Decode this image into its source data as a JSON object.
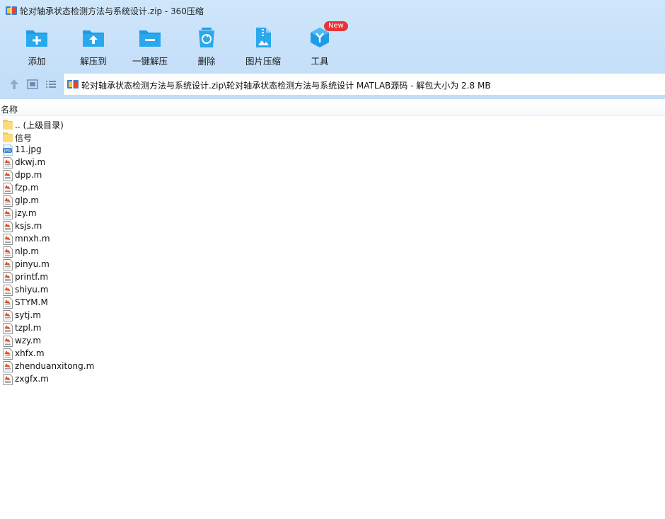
{
  "window": {
    "title": "轮对轴承状态检测方法与系统设计.zip - 360压缩"
  },
  "toolbar": {
    "items": [
      {
        "label": "添加",
        "icon": "add-icon"
      },
      {
        "label": "解压到",
        "icon": "extract-to-icon"
      },
      {
        "label": "一键解压",
        "icon": "one-click-extract-icon"
      },
      {
        "label": "删除",
        "icon": "delete-icon"
      },
      {
        "label": "图片压缩",
        "icon": "image-compress-icon"
      },
      {
        "label": "工具",
        "icon": "tools-icon",
        "badge": "New"
      }
    ]
  },
  "nav": {
    "path": "轮对轴承状态检测方法与系统设计.zip\\轮对轴承状态检测方法与系统设计 MATLAB源码 - 解包大小为 2.8 MB"
  },
  "columns": {
    "name": "名称"
  },
  "files": [
    {
      "name": ".. (上级目录)",
      "type": "folder"
    },
    {
      "name": "信号",
      "type": "folder"
    },
    {
      "name": "11.jpg",
      "type": "jpg"
    },
    {
      "name": "dkwj.m",
      "type": "matlab"
    },
    {
      "name": "dpp.m",
      "type": "matlab"
    },
    {
      "name": "fzp.m",
      "type": "matlab"
    },
    {
      "name": "glp.m",
      "type": "matlab"
    },
    {
      "name": "jzy.m",
      "type": "matlab"
    },
    {
      "name": "ksjs.m",
      "type": "matlab"
    },
    {
      "name": "mnxh.m",
      "type": "matlab"
    },
    {
      "name": "nlp.m",
      "type": "matlab"
    },
    {
      "name": "pinyu.m",
      "type": "matlab"
    },
    {
      "name": "printf.m",
      "type": "matlab"
    },
    {
      "name": "shiyu.m",
      "type": "matlab"
    },
    {
      "name": "STYM.M",
      "type": "matlab"
    },
    {
      "name": "sytj.m",
      "type": "matlab"
    },
    {
      "name": "tzpl.m",
      "type": "matlab"
    },
    {
      "name": "wzy.m",
      "type": "matlab"
    },
    {
      "name": "xhfx.m",
      "type": "matlab"
    },
    {
      "name": "zhenduanxitong.m",
      "type": "matlab"
    },
    {
      "name": "zxgfx.m",
      "type": "matlab"
    }
  ],
  "colors": {
    "chrome_bg": "#c6e0f9",
    "icon_blue": "#1e9be6",
    "folder_yellow": "#fbd46b",
    "badge_red": "#e5343a"
  }
}
